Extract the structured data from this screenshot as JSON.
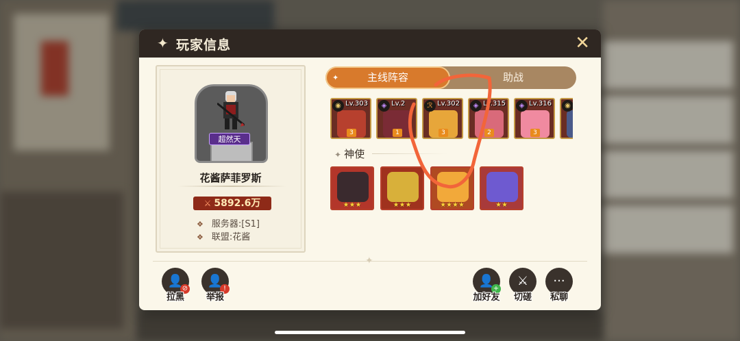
{
  "dialog": {
    "title": "玩家信息",
    "close_icon": "close-icon",
    "title_icon": "sparkle-icon"
  },
  "profile": {
    "player_name": "花酱萨菲罗斯",
    "rank_badge": "超然天",
    "power": "5892.6万",
    "server": "服务器:[S1]",
    "alliance": "联盟:花酱"
  },
  "tabs": [
    {
      "label": "主线阵容",
      "active": true
    },
    {
      "label": "助战",
      "active": false
    }
  ],
  "heroes": [
    {
      "level": "Lv.303",
      "element": "dark",
      "star": "3",
      "color": "#b7402e"
    },
    {
      "level": "Lv.2",
      "element": "void",
      "star": "1",
      "color": "#7a2b35"
    },
    {
      "level": "Lv.302",
      "element": "fire",
      "star": "3",
      "color": "#e7a63a"
    },
    {
      "level": "Lv.315",
      "element": "void",
      "star": "2",
      "color": "#d96a7a"
    },
    {
      "level": "Lv.316",
      "element": "void",
      "star": "3",
      "color": "#f08aa0"
    },
    {
      "level": "",
      "element": "dark",
      "star": "",
      "color": "#4a5a8a"
    }
  ],
  "envoy_section": {
    "label": "神使",
    "envoys": [
      {
        "stars": "★★★",
        "color": "#3a2a2e",
        "bg": "#b3362a"
      },
      {
        "stars": "★★★",
        "color": "#d8b03a",
        "bg": "#a0321e"
      },
      {
        "stars": "★★★★",
        "color": "#f2a93a",
        "bg": "#b04a22"
      },
      {
        "stars": "★★",
        "color": "#6e5ad0",
        "bg": "#a83a3a"
      }
    ]
  },
  "actions": {
    "block": {
      "label": "拉黑",
      "icon": "person-block-icon"
    },
    "report": {
      "label": "举报",
      "icon": "person-warning-icon"
    },
    "add_friend": {
      "label": "加好友",
      "icon": "person-add-icon"
    },
    "duel": {
      "label": "切磋",
      "icon": "crossed-swords-icon"
    },
    "chat": {
      "label": "私聊",
      "icon": "chat-bubble-icon"
    }
  },
  "colors": {
    "header_bg": "#2f2722",
    "panel_bg": "#fbf7ea",
    "tab_active": "#d87a2c",
    "tab_inactive": "#a88762",
    "power_bg": "#8e2a18",
    "annotation": "#f2653a"
  }
}
